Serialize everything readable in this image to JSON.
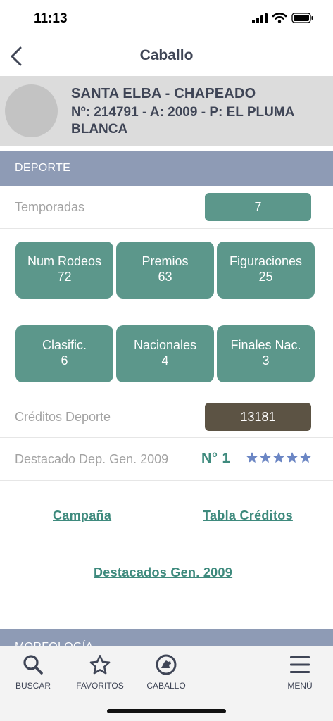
{
  "status": {
    "time": "11:13"
  },
  "nav": {
    "title": "Caballo"
  },
  "horse": {
    "name": "SANTA ELBA - CHAPEADO",
    "info": "Nº: 214791 - A: 2009 - P: EL PLUMA BLANCA"
  },
  "section": {
    "title": "DEPORTE"
  },
  "temporadas": {
    "label": "Temporadas",
    "value": "7"
  },
  "stats_row1": [
    {
      "label": "Num Rodeos",
      "value": "72"
    },
    {
      "label": "Premios",
      "value": "63"
    },
    {
      "label": "Figuraciones",
      "value": "25"
    }
  ],
  "stats_row2": [
    {
      "label": "Clasific.",
      "value": "6"
    },
    {
      "label": "Nacionales",
      "value": "4"
    },
    {
      "label": "Finales Nac.",
      "value": "3"
    }
  ],
  "creditos": {
    "label": "Créditos Deporte",
    "value": "13181"
  },
  "destacado": {
    "label": "Destacado Dep. Gen. 2009",
    "rank": "N° 1",
    "stars": 5
  },
  "links": {
    "campana": "Campaña",
    "tabla": "Tabla Créditos",
    "destacados": "Destacados Gen. 2009"
  },
  "next_section": {
    "title": "MORFOLOGÍA"
  },
  "tabs": [
    {
      "label": "BUSCAR",
      "icon": "search-icon"
    },
    {
      "label": "FAVORITOS",
      "icon": "star-icon"
    },
    {
      "label": "CABALLO",
      "icon": "horse-icon"
    },
    {
      "label": "MENÚ",
      "icon": "menu-icon"
    }
  ],
  "colors": {
    "accent_green": "#5c978b",
    "credits_brown": "#5c5344",
    "section_header": "#8e9bb5",
    "link_green": "#3e8a7d",
    "star_blue": "#6b86c4"
  }
}
